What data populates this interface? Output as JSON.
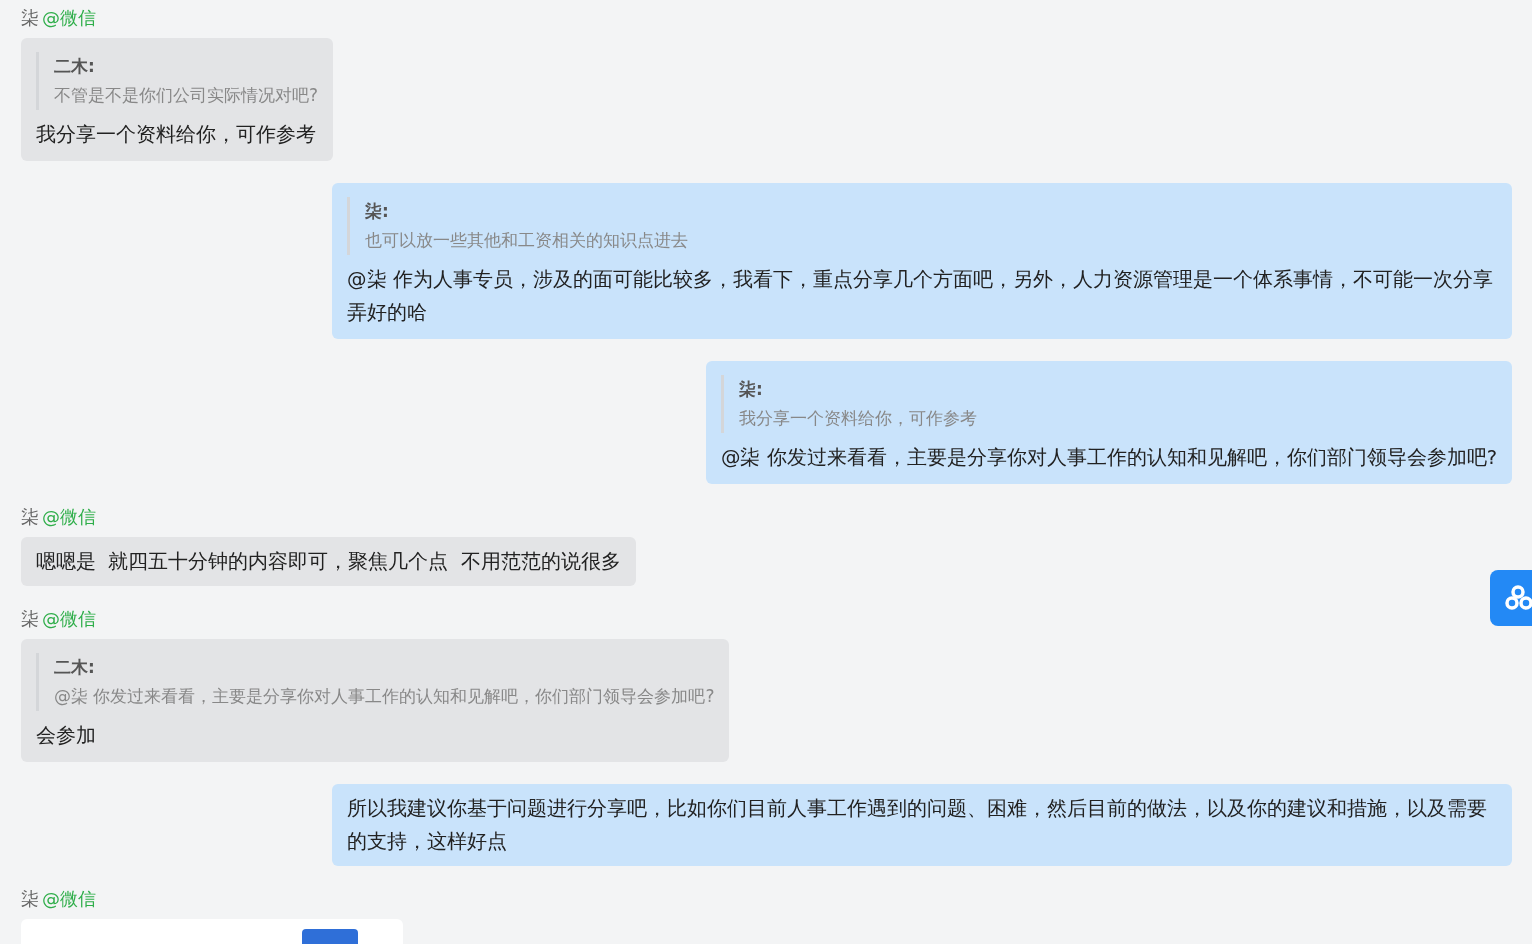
{
  "messages": [
    {
      "kind": "received",
      "sender": {
        "name": "柒",
        "source": "@微信"
      },
      "quote": {
        "author": "二木:",
        "text": "不管是不是你们公司实际情况对吧?"
      },
      "text": "我分享一个资料给你，可作参考"
    },
    {
      "kind": "sent",
      "quote": {
        "author": "柒:",
        "text": "也可以放一些其他和工资相关的知识点进去"
      },
      "text": "@柒 作为人事专员，涉及的面可能比较多，我看下，重点分享几个方面吧，另外，人力资源管理是一个体系事情，不可能一次分享弄好的哈"
    },
    {
      "kind": "sent",
      "quote": {
        "author": "柒:",
        "text": "我分享一个资料给你，可作参考"
      },
      "text": "@柒 你发过来看看，主要是分享你对人事工作的认知和见解吧，你们部门领导会参加吧?"
    },
    {
      "kind": "received",
      "sender": {
        "name": "柒",
        "source": "@微信"
      },
      "text": "嗯嗯是  就四五十分钟的内容即可，聚焦几个点  不用范范的说很多"
    },
    {
      "kind": "received",
      "sender": {
        "name": "柒",
        "source": "@微信"
      },
      "quote": {
        "author": "二木:",
        "text": "@柒  你发过来看看，主要是分享你对人事工作的认知和见解吧，你们部门领导会参加吧?"
      },
      "text": "会参加"
    },
    {
      "kind": "sent",
      "text": "所以我建议你基于问题进行分享吧，比如你们目前人事工作遇到的问题、困难，然后目前的做法，以及你的建议和措施，以及需要的支持，这样好点"
    },
    {
      "kind": "received_card",
      "sender": {
        "name": "柒",
        "source": "@微信"
      }
    }
  ]
}
